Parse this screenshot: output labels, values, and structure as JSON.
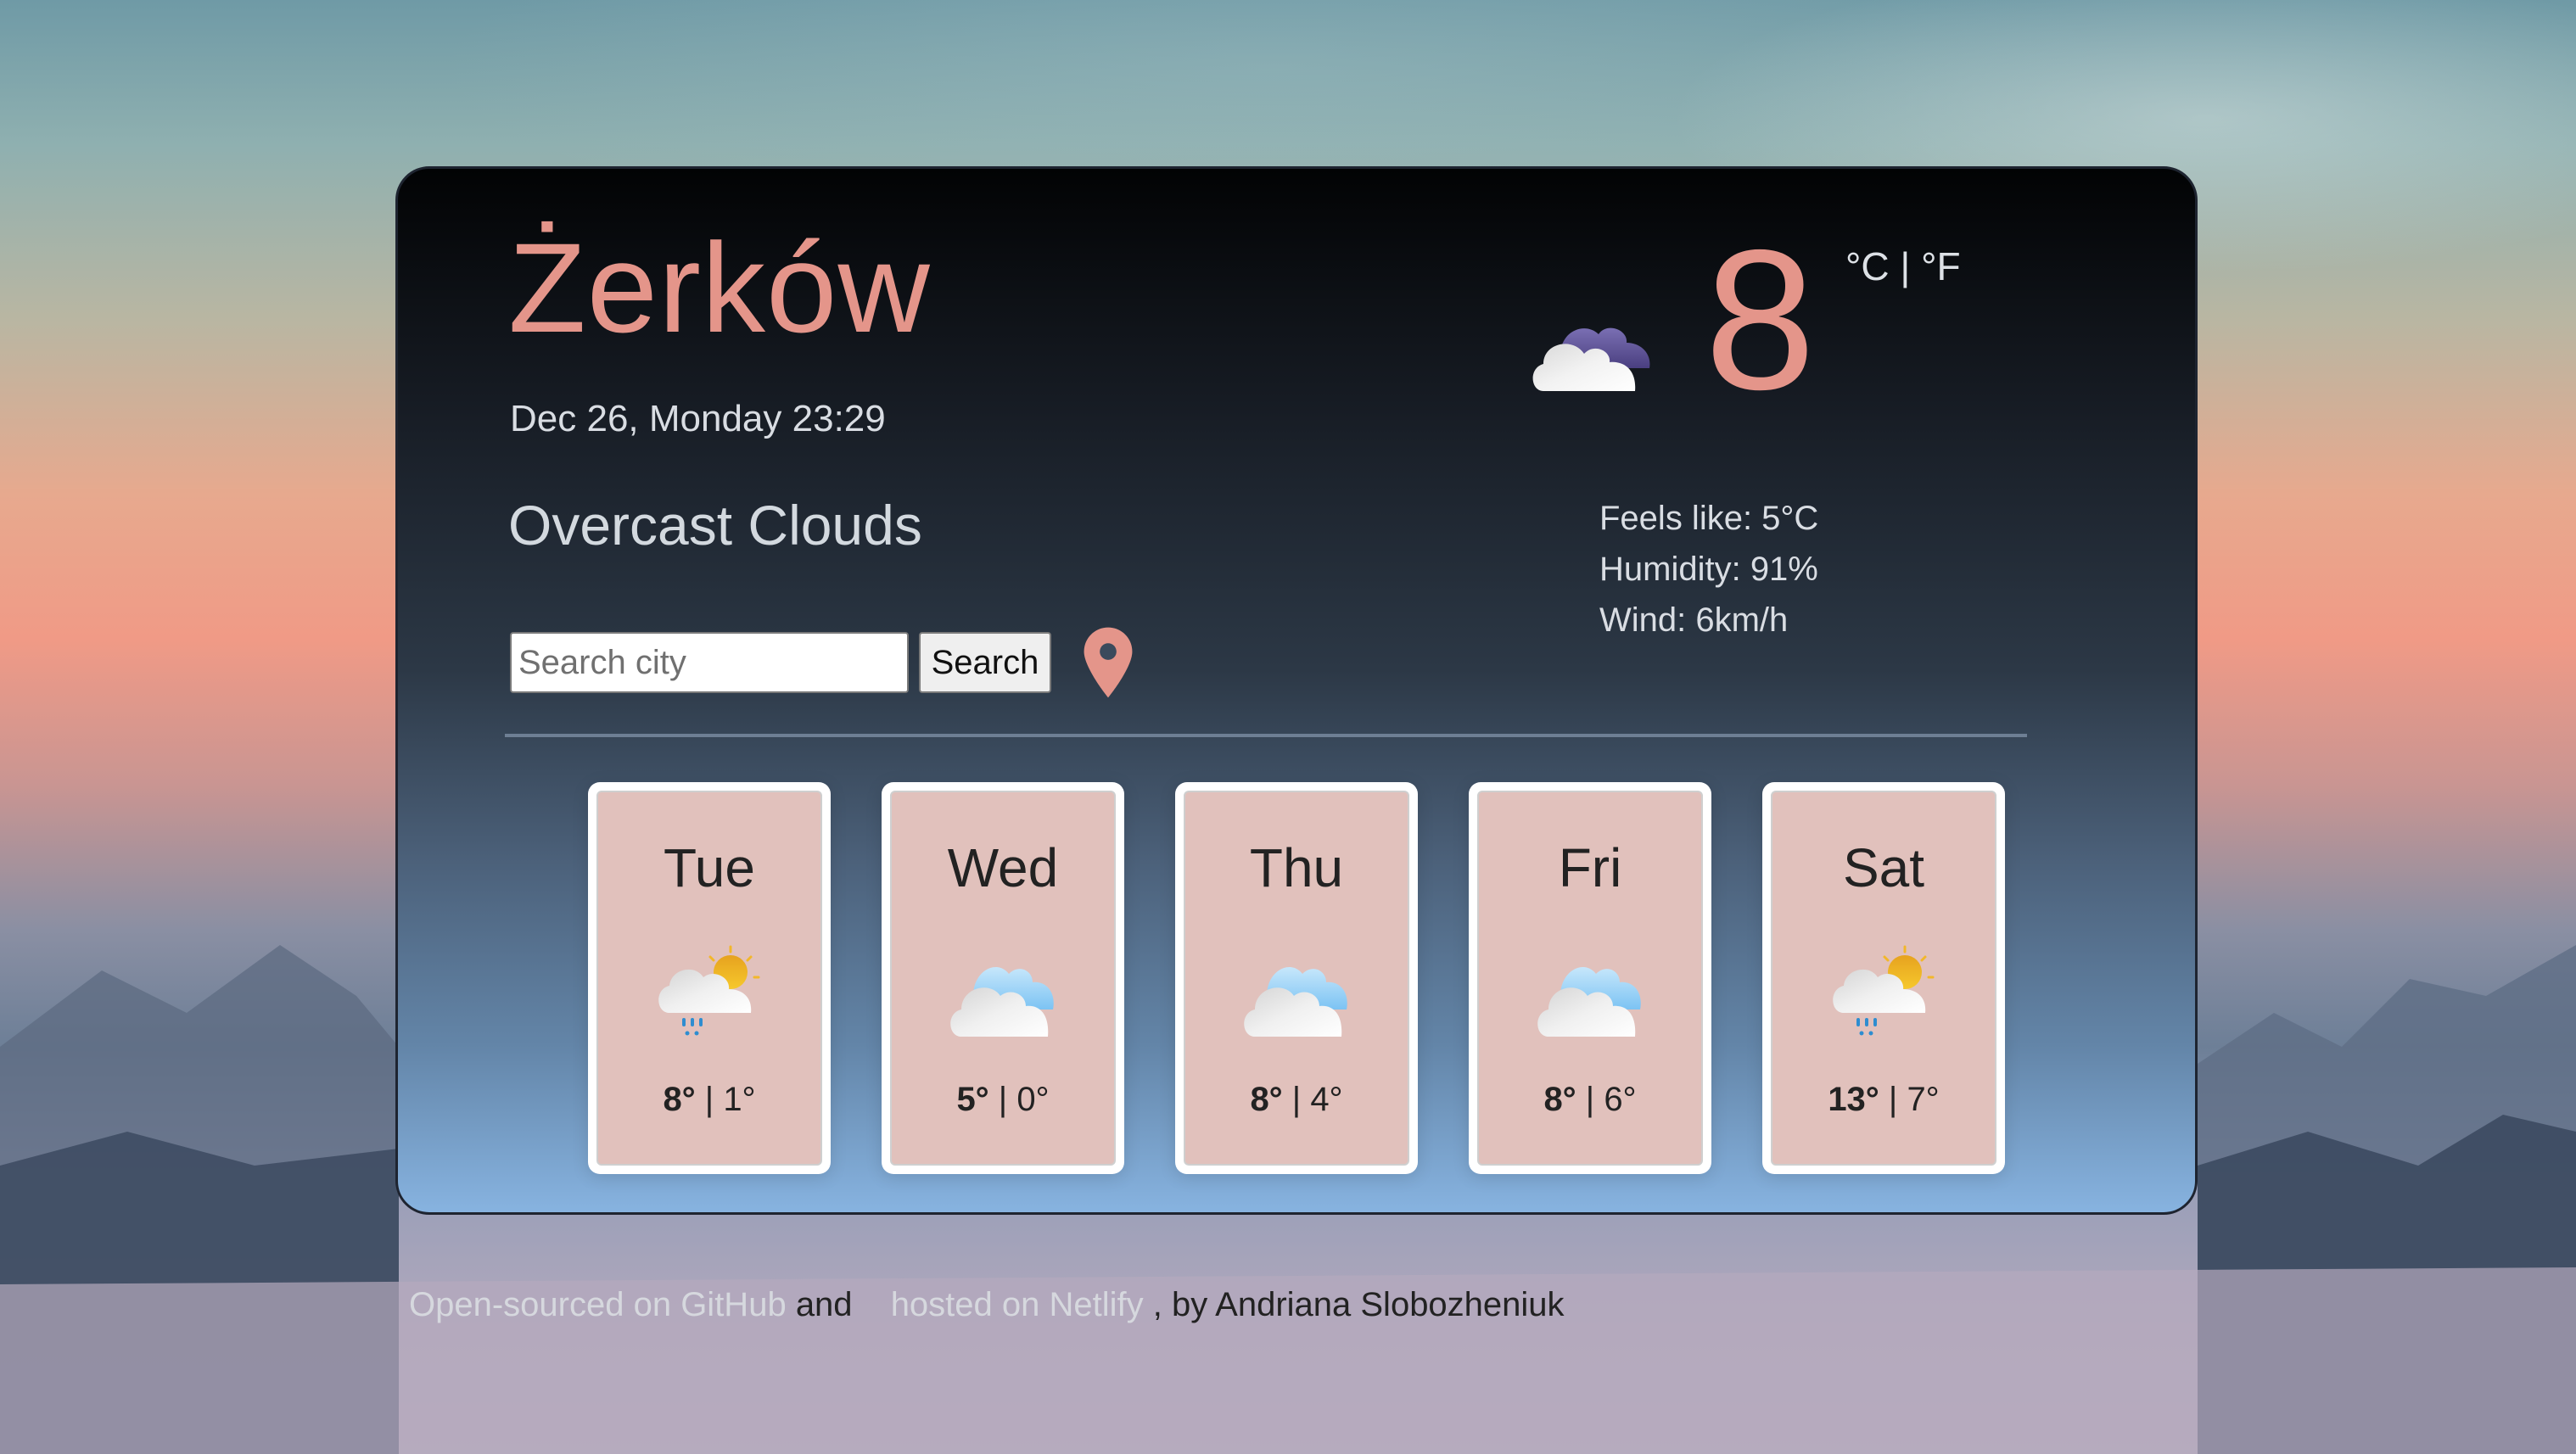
{
  "current": {
    "city": "Żerków",
    "datetime": "Dec 26, Monday 23:29",
    "description": "Overcast Clouds",
    "temperature": "8",
    "icon": "overcast-clouds-icon",
    "unit_celsius": "°C",
    "unit_separator": " | ",
    "unit_fahrenheit": "°F",
    "feels_like": "Feels like: 5°C",
    "humidity": "Humidity: 91%",
    "wind": "Wind: 6km/h"
  },
  "search": {
    "placeholder": "Search city",
    "value": "",
    "button_label": "Search",
    "location_icon": "map-pin-icon"
  },
  "forecast": [
    {
      "day": "Tue",
      "icon": "sun-cloud-rain-icon",
      "max": "8°",
      "min": "1°"
    },
    {
      "day": "Wed",
      "icon": "cloudy-icon",
      "max": "5°",
      "min": "0°"
    },
    {
      "day": "Thu",
      "icon": "cloudy-icon",
      "max": "8°",
      "min": "4°"
    },
    {
      "day": "Fri",
      "icon": "cloudy-icon",
      "max": "8°",
      "min": "6°"
    },
    {
      "day": "Sat",
      "icon": "sun-cloud-rain-icon",
      "max": "13°",
      "min": "7°"
    }
  ],
  "forecast_separator": " | ",
  "footer": {
    "github_link": "Open-sourced on GitHub",
    "and_text": "and",
    "netlify_link": "hosted on Netlify",
    "author_text": ", by Andriana Slobozheniuk"
  },
  "colors": {
    "accent": "#e4958a",
    "forecast_card": "#e1c1bc",
    "text_light": "#d9dde3"
  }
}
